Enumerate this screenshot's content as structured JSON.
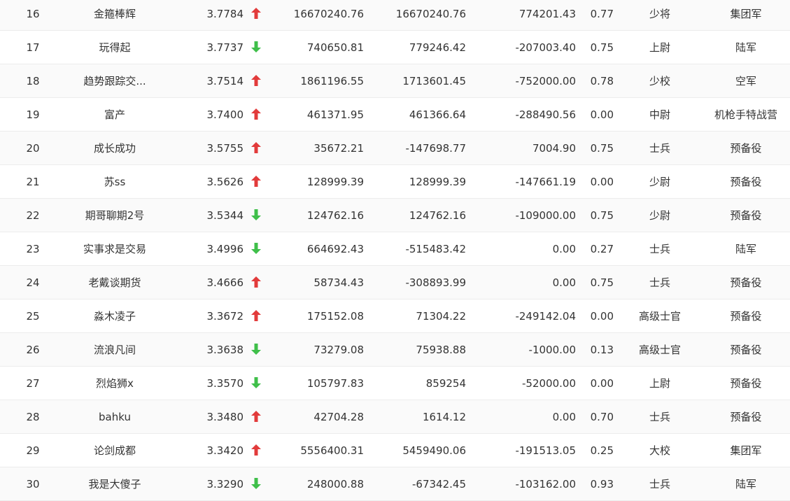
{
  "colors": {
    "up": "#e23b3b",
    "down": "#3fbf4a"
  },
  "rows": [
    {
      "rank": "16",
      "name": "金箍棒辉",
      "score": "3.7784",
      "trend": "up",
      "v1": "16670240.76",
      "v2": "16670240.76",
      "v3": "774201.43",
      "ratio": "0.77",
      "title": "少将",
      "unit": "集团军"
    },
    {
      "rank": "17",
      "name": "玩得起",
      "score": "3.7737",
      "trend": "down",
      "v1": "740650.81",
      "v2": "779246.42",
      "v3": "-207003.40",
      "ratio": "0.75",
      "title": "上尉",
      "unit": "陆军"
    },
    {
      "rank": "18",
      "name": "趋势跟踪交...",
      "score": "3.7514",
      "trend": "up",
      "v1": "1861196.55",
      "v2": "1713601.45",
      "v3": "-752000.00",
      "ratio": "0.78",
      "title": "少校",
      "unit": "空军"
    },
    {
      "rank": "19",
      "name": "富产",
      "score": "3.7400",
      "trend": "up",
      "v1": "461371.95",
      "v2": "461366.64",
      "v3": "-288490.56",
      "ratio": "0.00",
      "title": "中尉",
      "unit": "机枪手特战营"
    },
    {
      "rank": "20",
      "name": "成长成功",
      "score": "3.5755",
      "trend": "up",
      "v1": "35672.21",
      "v2": "-147698.77",
      "v3": "7004.90",
      "ratio": "0.75",
      "title": "士兵",
      "unit": "预备役"
    },
    {
      "rank": "21",
      "name": "苏ss",
      "score": "3.5626",
      "trend": "up",
      "v1": "128999.39",
      "v2": "128999.39",
      "v3": "-147661.19",
      "ratio": "0.00",
      "title": "少尉",
      "unit": "预备役"
    },
    {
      "rank": "22",
      "name": "期哥聊期2号",
      "score": "3.5344",
      "trend": "down",
      "v1": "124762.16",
      "v2": "124762.16",
      "v3": "-109000.00",
      "ratio": "0.75",
      "title": "少尉",
      "unit": "预备役"
    },
    {
      "rank": "23",
      "name": "实事求是交易",
      "score": "3.4996",
      "trend": "down",
      "v1": "664692.43",
      "v2": "-515483.42",
      "v3": "0.00",
      "ratio": "0.27",
      "title": "士兵",
      "unit": "陆军"
    },
    {
      "rank": "24",
      "name": "老戴谈期货",
      "score": "3.4666",
      "trend": "up",
      "v1": "58734.43",
      "v2": "-308893.99",
      "v3": "0.00",
      "ratio": "0.75",
      "title": "士兵",
      "unit": "预备役"
    },
    {
      "rank": "25",
      "name": "淼木凌子",
      "score": "3.3672",
      "trend": "up",
      "v1": "175152.08",
      "v2": "71304.22",
      "v3": "-249142.04",
      "ratio": "0.00",
      "title": "高级士官",
      "unit": "预备役"
    },
    {
      "rank": "26",
      "name": "流浪凡间",
      "score": "3.3638",
      "trend": "down",
      "v1": "73279.08",
      "v2": "75938.88",
      "v3": "-1000.00",
      "ratio": "0.13",
      "title": "高级士官",
      "unit": "预备役"
    },
    {
      "rank": "27",
      "name": "烈焰狮x",
      "score": "3.3570",
      "trend": "down",
      "v1": "105797.83",
      "v2": "859254",
      "v3": "-52000.00",
      "ratio": "0.00",
      "title": "上尉",
      "unit": "预备役"
    },
    {
      "rank": "28",
      "name": "bahku",
      "score": "3.3480",
      "trend": "up",
      "v1": "42704.28",
      "v2": "1614.12",
      "v3": "0.00",
      "ratio": "0.70",
      "title": "士兵",
      "unit": "预备役"
    },
    {
      "rank": "29",
      "name": "论剑成都",
      "score": "3.3420",
      "trend": "up",
      "v1": "5556400.31",
      "v2": "5459490.06",
      "v3": "-191513.05",
      "ratio": "0.25",
      "title": "大校",
      "unit": "集团军"
    },
    {
      "rank": "30",
      "name": "我是大傻子",
      "score": "3.3290",
      "trend": "down",
      "v1": "248000.88",
      "v2": "-67342.45",
      "v3": "-103162.00",
      "ratio": "0.93",
      "title": "士兵",
      "unit": "陆军"
    }
  ]
}
